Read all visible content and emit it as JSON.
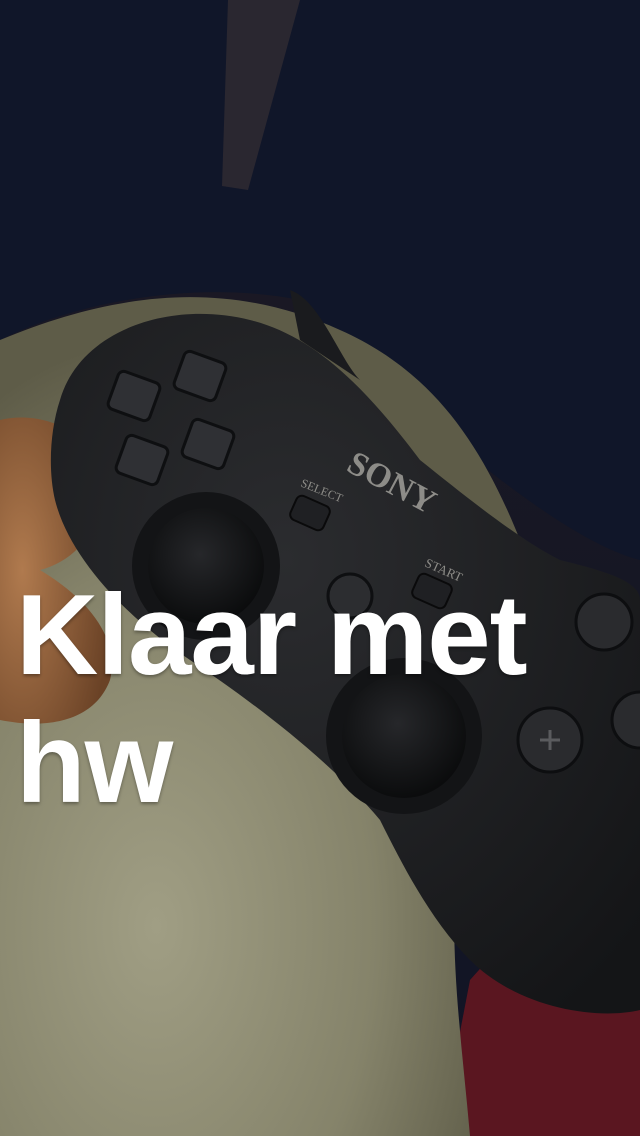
{
  "snap": {
    "caption": "Klaar met\nhw"
  },
  "photo": {
    "controller_brand": "SONY",
    "select_label": "SELECT",
    "start_label": "START"
  }
}
